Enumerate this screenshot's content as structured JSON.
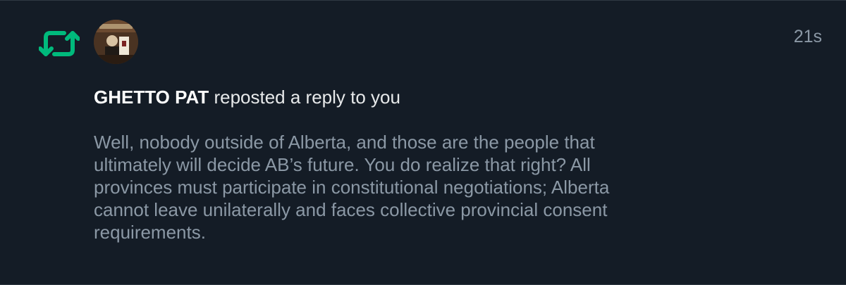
{
  "notification": {
    "icon": "repost-icon",
    "accent_color": "#00ba7c",
    "avatar_icon": "user-avatar",
    "timestamp": "21s",
    "user_name": "GHETTO PAT",
    "action_text": " reposted a reply to you",
    "body_lines": [
      "Well, nobody outside of Alberta, and those are the people that",
      "ultimately will decide AB’s future. You do realize that right?  All",
      "provinces must participate in constitutional negotiations; Alberta",
      "cannot leave unilaterally and faces collective provincial consent",
      "requirements."
    ]
  }
}
